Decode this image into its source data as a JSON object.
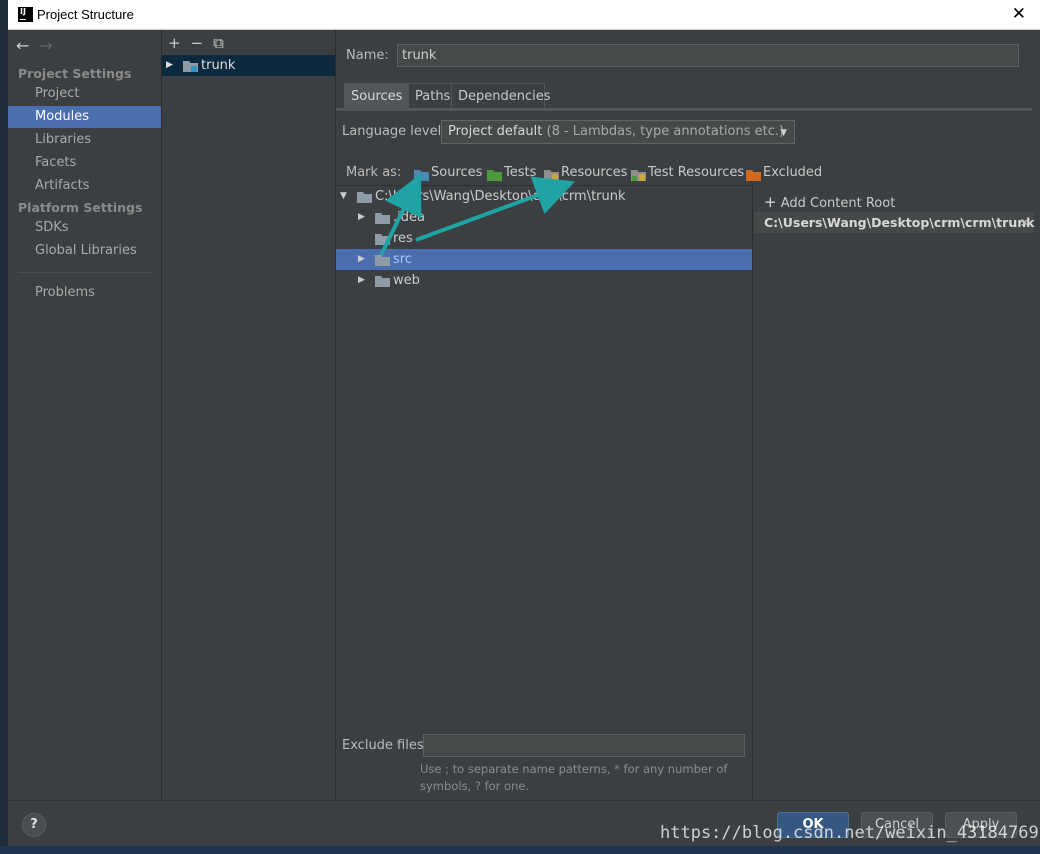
{
  "window": {
    "title": "Project Structure",
    "close_glyph": "✕"
  },
  "nav": {
    "back_glyph": "←",
    "forward_glyph": "→",
    "project_settings_heading": "Project Settings",
    "platform_settings_heading": "Platform Settings",
    "items": [
      {
        "label": "Project"
      },
      {
        "label": "Modules",
        "selected": true
      },
      {
        "label": "Libraries"
      },
      {
        "label": "Facets"
      },
      {
        "label": "Artifacts"
      },
      {
        "label": "SDKs"
      },
      {
        "label": "Global Libraries"
      },
      {
        "label": "Problems"
      }
    ]
  },
  "modules": {
    "toolbar": {
      "add": "+",
      "remove": "−",
      "copy": "⧉"
    },
    "items": [
      {
        "label": "trunk"
      }
    ]
  },
  "main": {
    "name_label": "Name:",
    "name_value": "trunk",
    "tabs": [
      {
        "label": "Sources",
        "active": true
      },
      {
        "label": "Paths"
      },
      {
        "label": "Dependencies"
      }
    ],
    "language_level_label": "Language level:",
    "language_level_value": "Project default",
    "language_level_detail": "(8 - Lambdas, type annotations etc.)",
    "mark_as_label": "Mark as:",
    "mark_buttons": [
      {
        "label": "Sources",
        "color": "#4a8ab5"
      },
      {
        "label": "Tests",
        "color": "#4c9a3c"
      },
      {
        "label": "Resources",
        "color": "#8f8f8f"
      },
      {
        "label": "Test Resources",
        "color": "#8f8f8f"
      },
      {
        "label": "Excluded",
        "color": "#d2691e"
      }
    ],
    "tree": [
      {
        "label": "C:\\Users\\Wang\\Desktop\\crm\\crm\\trunk",
        "expanded": true
      },
      {
        "label": ".idea"
      },
      {
        "label": "res"
      },
      {
        "label": "src",
        "selected": true
      },
      {
        "label": "web"
      }
    ],
    "exclude_files_label": "Exclude files:",
    "exclude_files_value": "",
    "hint_line1": "Use ; to separate name patterns, * for any number of",
    "hint_line2": "symbols, ? for one.",
    "add_content_root": "Add Content Root",
    "content_root": "C:\\Users\\Wang\\Desktop\\crm\\crm\\trunk",
    "remove_glyph": "✕"
  },
  "buttons": {
    "help": "?",
    "ok": "OK",
    "cancel": "Cancel",
    "apply": "Apply"
  },
  "watermark": "https://blog.csdn.net/weixin_43184769",
  "colors": {
    "accent": "#4b6eaf",
    "annotation_arrow": "#1fa3a3",
    "folder": "#8f9ba6"
  }
}
